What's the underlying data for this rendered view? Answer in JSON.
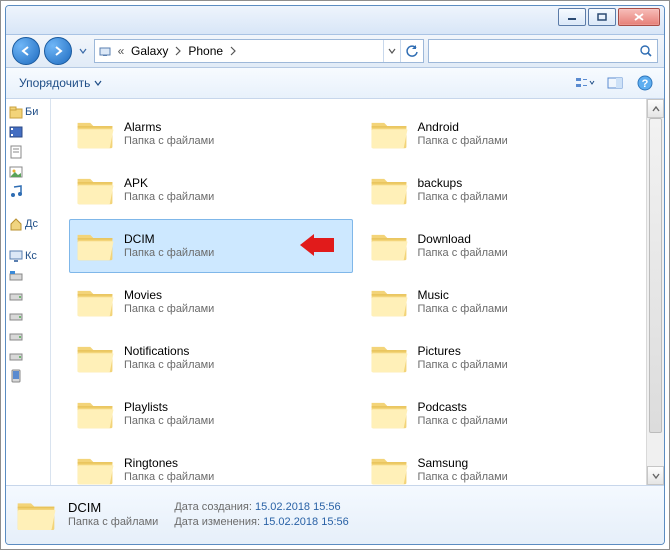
{
  "titlebar": {
    "min": "−",
    "max": "□",
    "close": "×"
  },
  "breadcrumb": {
    "level1": "Galaxy",
    "level2": "Phone"
  },
  "toolbar": {
    "organize": "Упорядочить"
  },
  "sidebar": {
    "items": [
      {
        "label": "Би",
        "icon": "folder"
      },
      {
        "label": "",
        "icon": "video"
      },
      {
        "label": "",
        "icon": "doc"
      },
      {
        "label": "",
        "icon": "image"
      },
      {
        "label": "",
        "icon": "music"
      },
      {
        "label": "Дс",
        "icon": "home",
        "spaced": true
      },
      {
        "label": "Кс",
        "icon": "computer",
        "spaced": true
      },
      {
        "label": "",
        "icon": "disk-win"
      },
      {
        "label": "",
        "icon": "drive"
      },
      {
        "label": "",
        "icon": "drive"
      },
      {
        "label": "",
        "icon": "drive"
      },
      {
        "label": "",
        "icon": "drive"
      },
      {
        "label": "",
        "icon": "phone"
      }
    ]
  },
  "folder_subtext": "Папка с файлами",
  "folders": [
    {
      "name": "Alarms"
    },
    {
      "name": "Android"
    },
    {
      "name": "APK"
    },
    {
      "name": "backups"
    },
    {
      "name": "DCIM",
      "selected": true,
      "arrow": true
    },
    {
      "name": "Download"
    },
    {
      "name": "Movies"
    },
    {
      "name": "Music"
    },
    {
      "name": "Notifications"
    },
    {
      "name": "Pictures"
    },
    {
      "name": "Playlists"
    },
    {
      "name": "Podcasts"
    },
    {
      "name": "Ringtones"
    },
    {
      "name": "Samsung"
    }
  ],
  "details": {
    "name": "DCIM",
    "sub": "Папка с файлами",
    "created_label": "Дата создания:",
    "created_value": "15.02.2018 15:56",
    "modified_label": "Дата изменения:",
    "modified_value": "15.02.2018 15:56"
  }
}
